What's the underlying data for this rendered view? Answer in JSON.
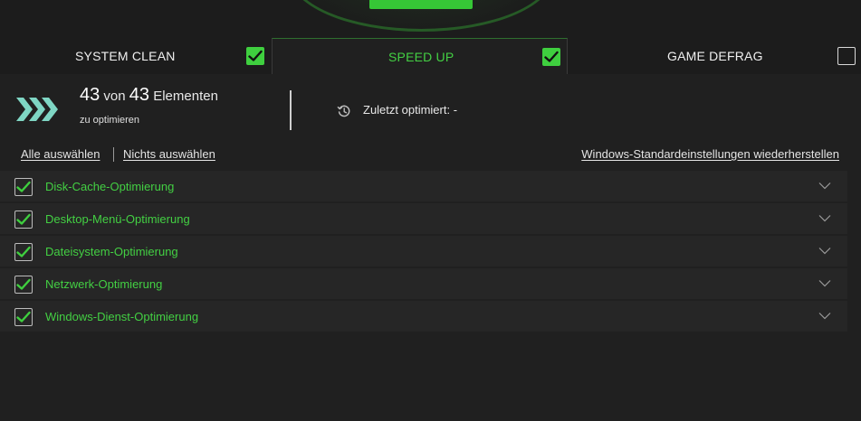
{
  "tabs": [
    {
      "label": "SYSTEM CLEAN",
      "checked": true
    },
    {
      "label": "SPEED UP",
      "checked": true,
      "active": true
    },
    {
      "label": "GAME DEFRAG",
      "checked": false
    }
  ],
  "summary": {
    "count": "43",
    "von": "von",
    "total": "43",
    "elements": "Elementen",
    "subtitle": "zu optimieren",
    "last_optimized_label": "Zuletzt optimiert:",
    "last_optimized_value": "-"
  },
  "links": {
    "select_all": "Alle auswählen",
    "select_none": "Nichts auswählen",
    "restore_defaults": "Windows-Standardeinstellungen wiederherstellen"
  },
  "items": [
    {
      "label": "Disk-Cache-Optimierung",
      "checked": true
    },
    {
      "label": "Desktop-Menü-Optimierung",
      "checked": true
    },
    {
      "label": "Dateisystem-Optimierung",
      "checked": true
    },
    {
      "label": "Netzwerk-Optimierung",
      "checked": true
    },
    {
      "label": "Windows-Dienst-Optimierung",
      "checked": true
    }
  ],
  "icons": {
    "chevrons": "triple-chevron-right-icon",
    "history": "history-clock-icon",
    "expand": "chevron-down-icon",
    "check": "check-icon"
  },
  "colors": {
    "accent_green": "#3fcf3f",
    "label_green": "#43d043",
    "chevron_teal": "#7fd6c4",
    "background": "#202020"
  }
}
